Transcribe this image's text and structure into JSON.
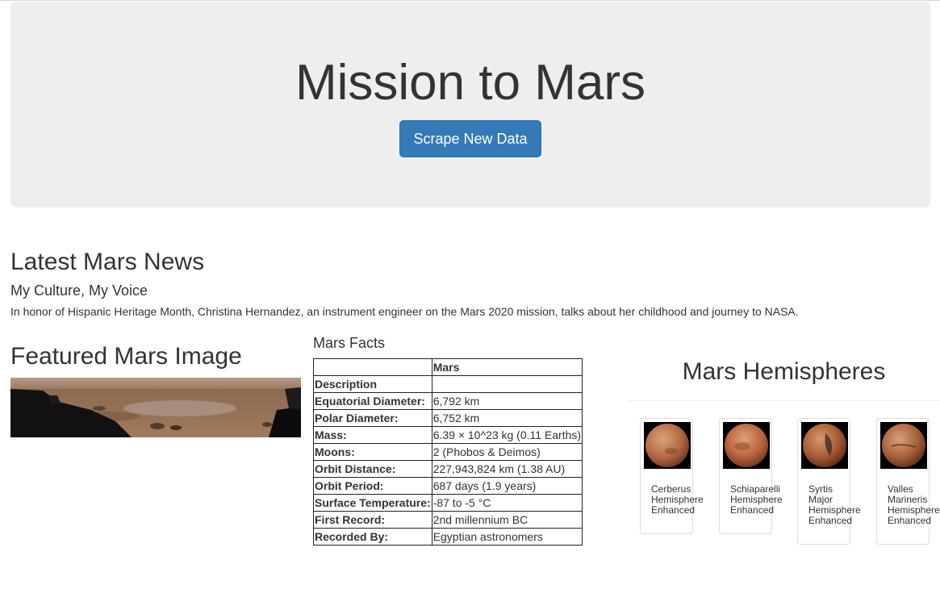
{
  "header": {
    "title": "Mission to Mars",
    "scrape_button": "Scrape New Data"
  },
  "news": {
    "heading": "Latest Mars News",
    "title": "My Culture, My Voice",
    "teaser": "In honor of Hispanic Heritage Month, Christina Hernandez, an instrument engineer on the Mars 2020 mission, talks about her childhood and journey to NASA."
  },
  "featured": {
    "heading": "Featured Mars Image"
  },
  "facts": {
    "heading": "Mars Facts",
    "column_header": "Mars",
    "rows": [
      {
        "label": "Description",
        "value": ""
      },
      {
        "label": "Equatorial Diameter:",
        "value": "6,792 km"
      },
      {
        "label": "Polar Diameter:",
        "value": "6,752 km"
      },
      {
        "label": "Mass:",
        "value": "6.39 × 10^23 kg (0.11 Earths)"
      },
      {
        "label": "Moons:",
        "value": "2 (Phobos & Deimos)"
      },
      {
        "label": "Orbit Distance:",
        "value": "227,943,824 km (1.38 AU)"
      },
      {
        "label": "Orbit Period:",
        "value": "687 days (1.9 years)"
      },
      {
        "label": "Surface Temperature:",
        "value": "-87 to -5 °C"
      },
      {
        "label": "First Record:",
        "value": "2nd millennium BC"
      },
      {
        "label": "Recorded By:",
        "value": "Egyptian astronomers"
      }
    ]
  },
  "hemispheres": {
    "heading": "Mars Hemispheres",
    "items": [
      {
        "title": "Cerberus\nHemisphere\nEnhanced"
      },
      {
        "title": "Schiaparelli\nHemisphere\nEnhanced"
      },
      {
        "title": "Syrtis\nMajor\nHemisphere\nEnhanced"
      },
      {
        "title": "Valles\nMarineris\nHemisphere\nEnhanced"
      }
    ]
  },
  "colors": {
    "primary_button": "#337ab7",
    "jumbotron_bg": "#eeeeee",
    "text": "#333333"
  }
}
